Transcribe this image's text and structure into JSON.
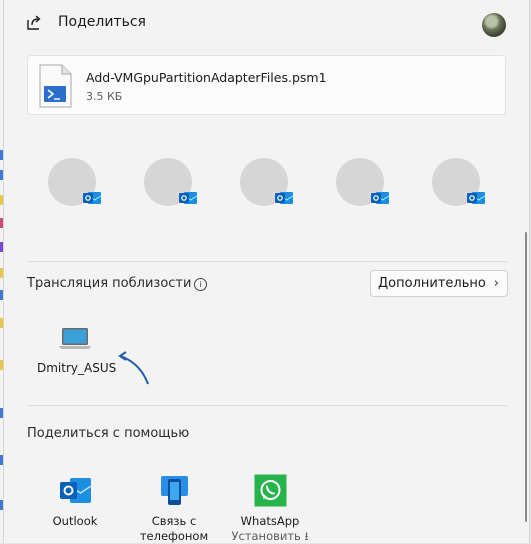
{
  "header": {
    "title": "Поделиться"
  },
  "file": {
    "name": "Add-VMGpuPartitionAdapterFiles.psm1",
    "size": "3.5 КБ"
  },
  "contacts": [
    {
      "badge": "outlook-badge-icon"
    },
    {
      "badge": "outlook-badge-icon"
    },
    {
      "badge": "outlook-badge-icon"
    },
    {
      "badge": "outlook-badge-icon"
    },
    {
      "badge": "outlook-badge-icon"
    }
  ],
  "nearby": {
    "title": "Трансляция поблизости",
    "more_button": "Дополнительно",
    "device": {
      "name": "Dmitry_ASUS",
      "icon": "laptop-icon"
    }
  },
  "share_with": {
    "title": "Поделиться с помощью",
    "apps": [
      {
        "label": "Outlook",
        "sub": "",
        "icon": "outlook-icon"
      },
      {
        "label": "Связь с",
        "sub": "телефоном",
        "icon": "phone-link-icon"
      },
      {
        "label": "WhatsApp",
        "sub": "Установить ⭳",
        "icon": "whatsapp-icon"
      }
    ]
  },
  "colors": {
    "accent": "#0a64c4",
    "whatsapp": "#25b34a",
    "panel": "#f3f3f3"
  }
}
